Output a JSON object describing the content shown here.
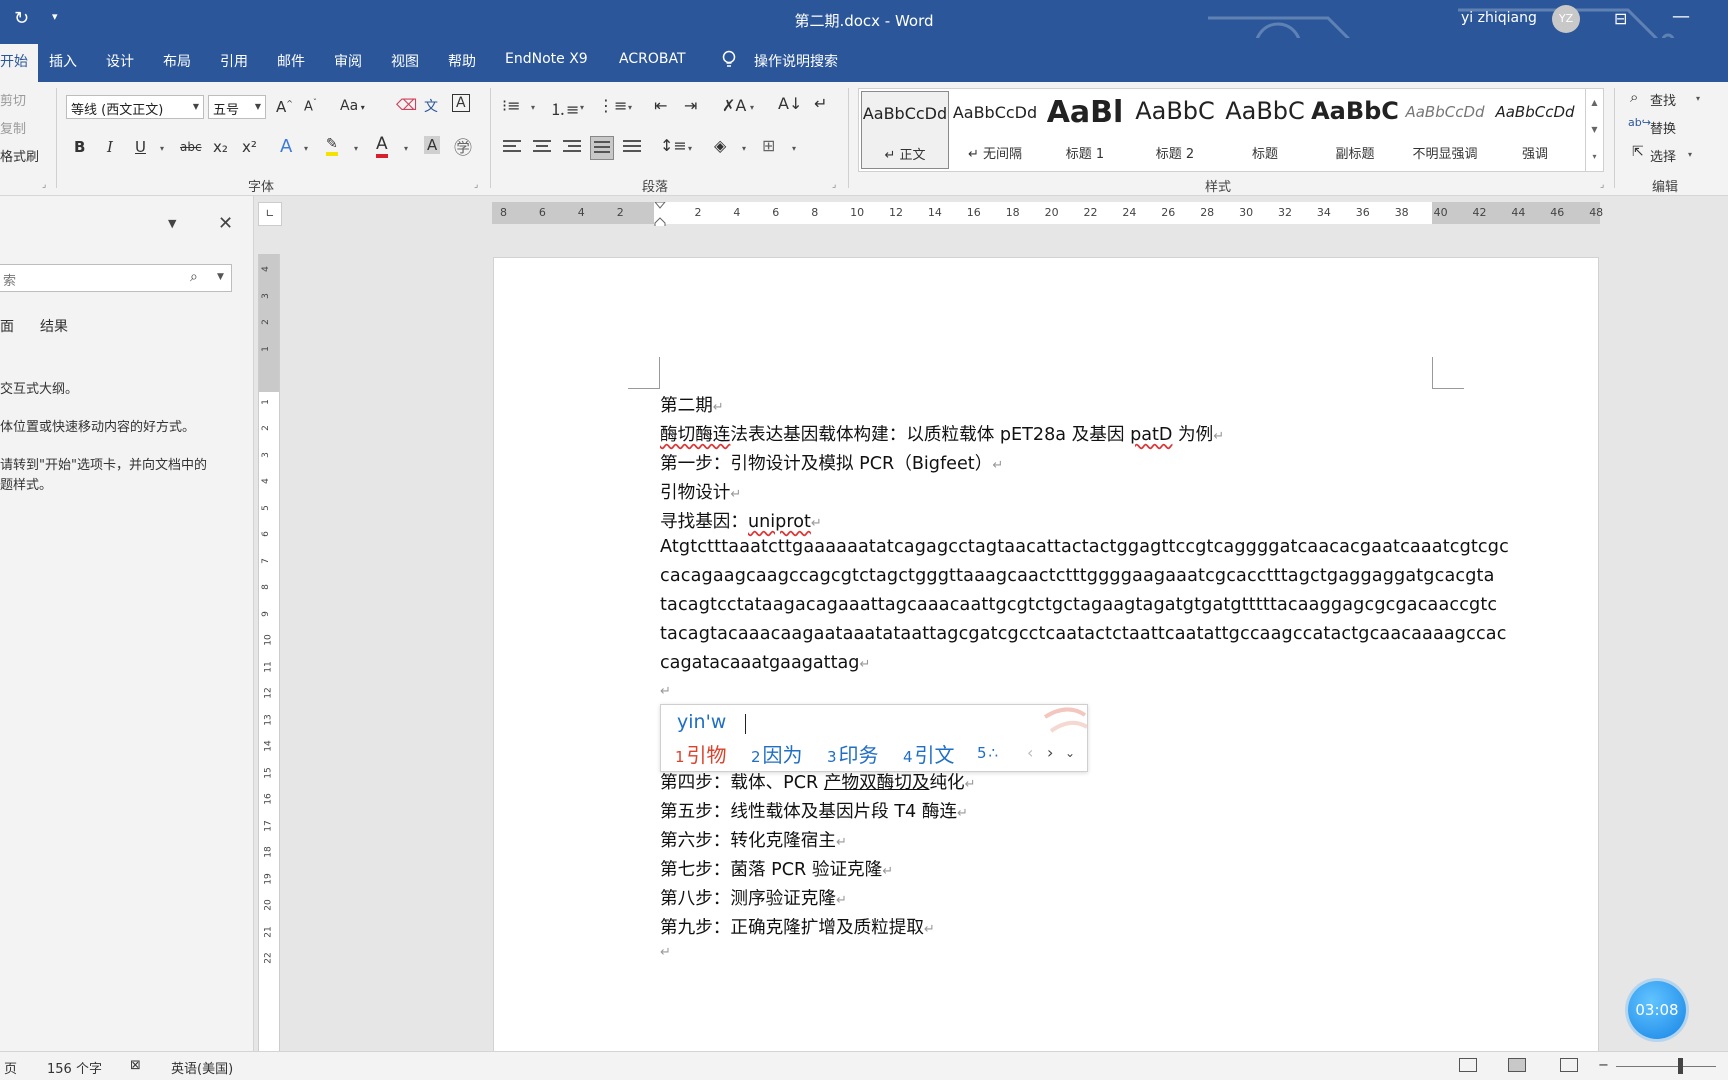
{
  "title_bar": {
    "document_title": "第二期.docx  -  Word",
    "user_name": "yi zhiqiang",
    "avatar_initials": "YZ",
    "accent_color": "#2b579a"
  },
  "tabs": [
    {
      "label": "开始",
      "active": true
    },
    {
      "label": "插入"
    },
    {
      "label": "设计"
    },
    {
      "label": "布局"
    },
    {
      "label": "引用"
    },
    {
      "label": "邮件"
    },
    {
      "label": "审阅"
    },
    {
      "label": "视图"
    },
    {
      "label": "帮助"
    },
    {
      "label": "EndNote X9"
    },
    {
      "label": "ACROBAT"
    }
  ],
  "tell_me": "操作说明搜索",
  "clipboard": {
    "cut": "剪切",
    "copy": "复制",
    "format_painter": "格式刷"
  },
  "font_group": {
    "font_name": "等线 (西文正文)",
    "font_size": "五号",
    "label": "字体",
    "bold": "B",
    "italic": "I",
    "underline": "U",
    "strike": "abc",
    "subscript": "x₂",
    "superscript": "x²",
    "grow": "A",
    "shrink": "A",
    "case": "Aa",
    "phonetic": "文",
    "border_char": "A"
  },
  "paragraph_group": {
    "label": "段落"
  },
  "styles_group": {
    "label": "样式",
    "items": [
      {
        "sample": "AaBbCcDd",
        "name": "↵ 正文",
        "selected": true
      },
      {
        "sample": "AaBbCcDd",
        "name": "↵ 无间隔"
      },
      {
        "sample": "AaBl",
        "name": "标题 1"
      },
      {
        "sample": "AaBbC",
        "name": "标题 2"
      },
      {
        "sample": "AaBbC",
        "name": "标题"
      },
      {
        "sample": "AaBbC",
        "name": "副标题"
      },
      {
        "sample": "AaBbCcDd",
        "name": "不明显强调"
      },
      {
        "sample": "AaBbCcDd",
        "name": "强调"
      }
    ]
  },
  "editing_group": {
    "label": "编辑",
    "find": "查找",
    "replace": "替换",
    "select": "选择"
  },
  "nav_pane": {
    "search_placeholder": "索",
    "tab_pages": "面",
    "tab_results": "结果",
    "hint_line1": "交互式大纲。",
    "hint_line2": "体位置或快速移动内容的好方式。",
    "hint_line3": "请转到\"开始\"选项卡，并向文档中的",
    "hint_line4": "题样式。"
  },
  "document": {
    "line1": "第二期",
    "line2_a": "酶切酶连",
    "line2_b": "法表达基因载体构建：以质粒载体 pET28a 及基因 ",
    "line2_c": "patD",
    "line2_d": " 为例",
    "line3": "第一步：引物设计及模拟 PCR（Bigfeet）",
    "line4": "引物设计",
    "line5_a": "寻找基因：",
    "line5_b": "uniprot",
    "seq1": "Atgtctttaaatcttgaaaaaatatcagagcctagtaacattactactggagttccgtcaggggatcaacacgaatcaaatcgtcgc",
    "seq2": "cacagaagcaagccagcgtctagctgggttaaagcaactctttggggaagaaatcgcacctttagctgaggaggatgcacgta",
    "seq3": "tacagtcctataagacagaaattagcaaacaattgcgtctgctagaagtagatgtgatgtttttacaaggagcgcgacaaccgtc",
    "seq4": "tacagtacaaacaagaataaatataattagcgatcgcctcaatactctaattcaatattgccaagccatactgcaacaaaagccac",
    "seq5": "cagatacaaatgaagattag",
    "step4_a": "第四步：载体、PCR ",
    "step4_b": "产物双酶切及",
    "step4_c": "纯化",
    "step5": "第五步：线性载体及基因片段 T4 酶连",
    "step6": "第六步：转化克隆宿主",
    "step7": "第七步：菌落 PCR 验证克隆",
    "step8": "第八步：测序验证克隆",
    "step9": "第九步：正确克隆扩增及质粒提取",
    "para_mark": "↵"
  },
  "ime": {
    "composition": "yin'w",
    "candidates": [
      {
        "index": "1",
        "text": "引物"
      },
      {
        "index": "2",
        "text": "因为"
      },
      {
        "index": "3",
        "text": "印务"
      },
      {
        "index": "4",
        "text": "引文"
      },
      {
        "index": "5",
        "text": "∴"
      }
    ]
  },
  "status_bar": {
    "page": "页",
    "word_count": "156 个字",
    "language": "英语(美国)"
  },
  "timer": "03:08",
  "hruler_ticks": [
    "8",
    "6",
    "4",
    "2",
    "",
    "2",
    "4",
    "6",
    "8",
    "10",
    "12",
    "14",
    "16",
    "18",
    "20",
    "22",
    "24",
    "26",
    "28",
    "30",
    "32",
    "34",
    "36",
    "38",
    "40",
    "42",
    "44",
    "46",
    "48"
  ],
  "vruler_ticks": [
    "4",
    "3",
    "2",
    "1",
    "",
    "1",
    "2",
    "3",
    "4",
    "5",
    "6",
    "7",
    "8",
    "9",
    "10",
    "11",
    "12",
    "13",
    "14",
    "15",
    "16",
    "17",
    "18",
    "19",
    "20",
    "21",
    "22"
  ]
}
